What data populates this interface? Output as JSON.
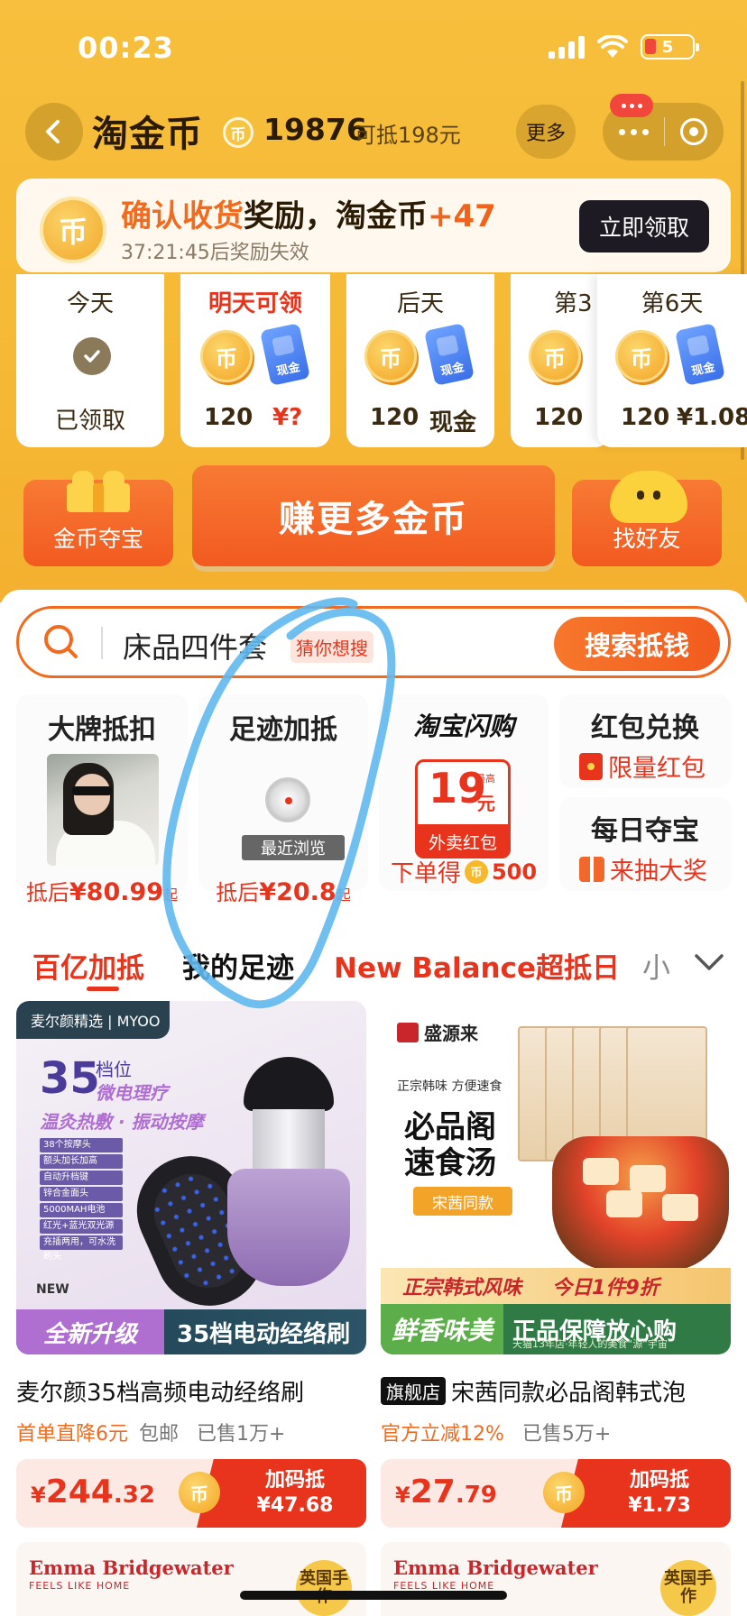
{
  "status_bar": {
    "time": "00:23",
    "battery": "5"
  },
  "header": {
    "title": "淘金币",
    "coin_symbol": "币",
    "balance": "19876",
    "deduct": "可抵198元",
    "more": "更多"
  },
  "reward_banner": {
    "title_orange": "确认收货",
    "title_black": "奖励，淘金币",
    "title_plus": "+47",
    "countdown": "37:21:45后奖励失效",
    "button": "立即领取",
    "coin_symbol": "币"
  },
  "days": [
    {
      "label": "今天",
      "status": "已领取",
      "highlight": false
    },
    {
      "label": "明天可领",
      "coin": "120",
      "cash": "¥?",
      "cash_icon_text": "现金",
      "highlight": true
    },
    {
      "label": "后天",
      "coin": "120",
      "cash": "现金",
      "cash_icon_text": "现金",
      "highlight": false
    },
    {
      "label": "第3",
      "coin": "120",
      "highlight": false
    },
    {
      "label": "第6天",
      "coin": "120",
      "cash": "¥1.08",
      "cash_icon_text": "现金",
      "highlight": false
    }
  ],
  "actions": {
    "treasure": "金币夺宝",
    "earn": "赚更多金币",
    "friends": "找好友"
  },
  "search": {
    "text": "床品四件套",
    "tag": "猜你想搜",
    "button": "搜索抵钱"
  },
  "features": {
    "brand": {
      "title": "大牌抵扣",
      "price_prefix": "抵后",
      "price": "¥80.99",
      "suffix": "起"
    },
    "footprint": {
      "title": "足迹加抵",
      "tag": "最近浏览",
      "price_prefix": "抵后",
      "price": "¥20.8",
      "suffix": "起"
    },
    "flash": {
      "title": "淘宝闪购",
      "amount": "19",
      "unit": "元",
      "max": "最高",
      "band": "外卖红包",
      "bottom_text": "下单得",
      "bottom_coins": "500"
    },
    "hongbao": {
      "title": "红包兑换",
      "sub": "限量红包"
    },
    "daily": {
      "title": "每日夺宝",
      "sub": "来抽大奖"
    }
  },
  "tabs": [
    "百亿加抵",
    "我的足迹",
    "New Balance超抵日",
    "小"
  ],
  "products": [
    {
      "image": {
        "brand": "麦尔颜精选 | MYOO",
        "big": "35",
        "big_sub": "档位",
        "line1": "微电理疗",
        "line2": "温灸热敷 · 振动按摩",
        "features": [
          "38个按摩头",
          "额头加长加高",
          "自动升档键",
          "锌合金面头",
          "5000MAH电池",
          "红光+蓝光双光源",
          "充插两用，可水洗刷头"
        ],
        "badge_new": "NEW",
        "band_left": "全新升级",
        "band_right": "35档电动经络刷"
      },
      "title": "麦尔颜35档高频电动经络刷",
      "promo": "首单直降6元",
      "shipping": "包邮",
      "sold": "已售1万+",
      "price_symbol": "¥",
      "price_int": "244",
      "price_dec": ".32",
      "btn_line1": "加码抵",
      "btn_line2": "¥47.68"
    },
    {
      "image": {
        "brand": "盛源来",
        "sub": "正宗韩味 方便速食",
        "headline1": "必品阁",
        "headline2": "速食汤",
        "tag": "宋茜同款",
        "band1_left": "正宗韩式风味",
        "band1_right": "今日1件9折",
        "band2_left": "鲜香味美",
        "band2_right": "正品保障放心购",
        "band2_small": "天猫13年店·年轻人的美食“源”宇宙"
      },
      "flag": "旗舰店",
      "title": "宋茜同款必品阁韩式泡",
      "promo": "官方立减12%",
      "sold": "已售5万+",
      "price_symbol": "¥",
      "price_int": "27",
      "price_dec": ".79",
      "btn_line1": "加码抵",
      "btn_line2": "¥1.73"
    }
  ],
  "bottom_cards": [
    {
      "brand": "Emma Bridgewater",
      "slogan": "FEELS LIKE HOME",
      "badge": "英国手作"
    },
    {
      "brand": "Emma Bridgewater",
      "slogan": "FEELS LIKE HOME",
      "badge": "英国手作"
    }
  ],
  "colors": {
    "top_bg": "#f5b935",
    "accent_orange": "#f26a1d",
    "accent_red": "#e8341c",
    "annotation_blue": "#5fb8ee"
  }
}
